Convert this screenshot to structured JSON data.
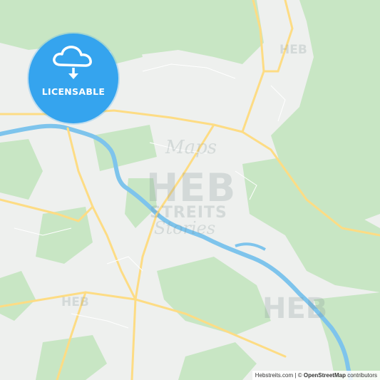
{
  "badge": {
    "label": "LICENSABLE",
    "icon": "cloud-download-icon",
    "color": "#35a4ee"
  },
  "watermark": {
    "brand": "HEB",
    "sub": "STREITS",
    "script_top": "Maps",
    "script_bottom": "Stories"
  },
  "attribution": {
    "site": "Hebstreits.com",
    "separator": "|",
    "copyright": "©",
    "osm": "OpenStreetMap",
    "suffix": "contributors"
  },
  "colors": {
    "forest": "#c8e6c4",
    "urban": "#eef0ee",
    "road": "#fddc84",
    "river": "#7ec4ec",
    "minor_road": "#ffffff"
  }
}
